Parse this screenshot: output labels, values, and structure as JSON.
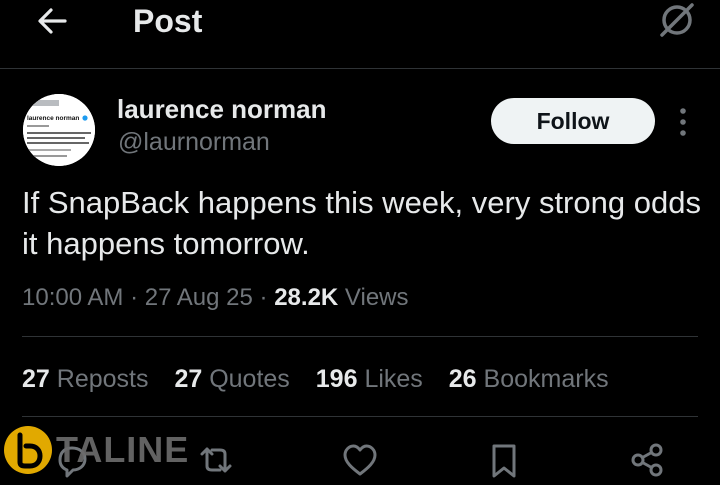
{
  "header": {
    "title": "Post",
    "back_icon": "arrow-left-icon",
    "grok_icon": "grok-icon"
  },
  "author": {
    "name": "laurence norman",
    "handle": "@laurnorman",
    "follow_label": "Follow",
    "avatar_caption": "laurence norman"
  },
  "post": {
    "text": "If SnapBack happens this week, very strong odds it happens tomorrow.",
    "time": "10:00 AM",
    "date": "27 Aug 25",
    "views_count": "28.2K",
    "views_label": "Views"
  },
  "stats": {
    "reposts": {
      "count": "27",
      "label": "Reposts"
    },
    "quotes": {
      "count": "27",
      "label": "Quotes"
    },
    "likes": {
      "count": "196",
      "label": "Likes"
    },
    "bookmarks": {
      "count": "26",
      "label": "Bookmarks"
    }
  },
  "actions": [
    "reply-icon",
    "repost-icon",
    "like-icon",
    "bookmark-icon",
    "share-icon"
  ],
  "watermark": {
    "text": "TALINE"
  },
  "colors": {
    "background": "#000000",
    "text": "#e7e9ea",
    "muted": "#71767b",
    "divider": "#2f3336",
    "button": "#eff3f4",
    "watermark_logo": "#f5b800"
  }
}
